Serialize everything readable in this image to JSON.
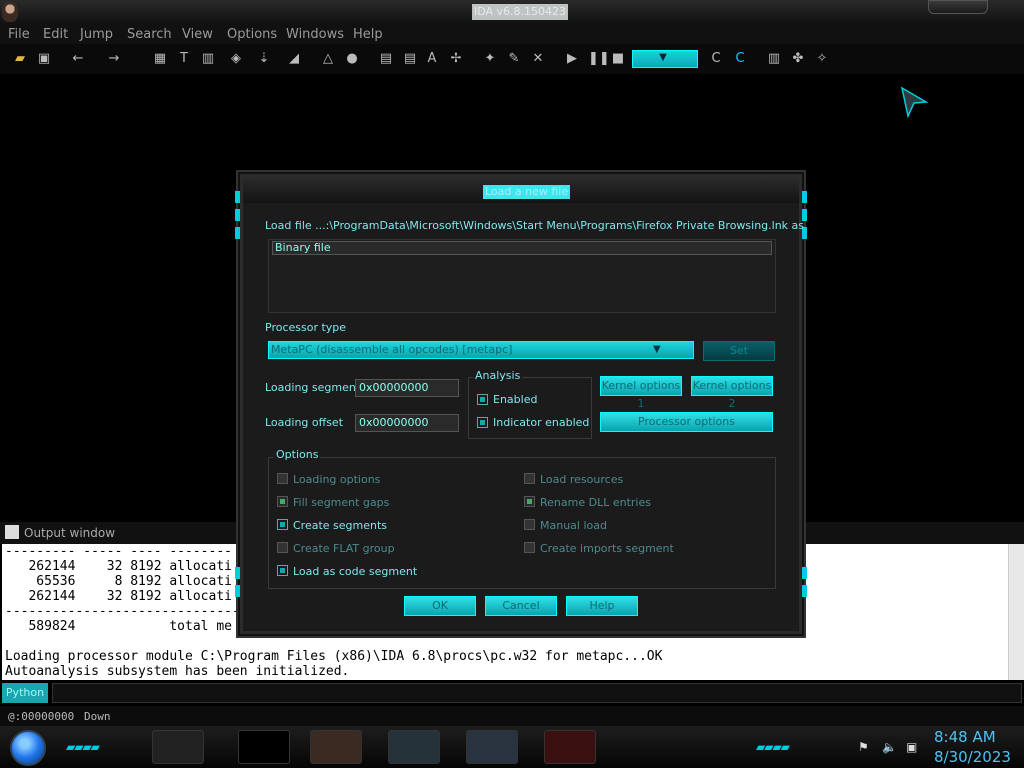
{
  "window": {
    "title": "IDA v6.8.150423"
  },
  "menu": [
    "File",
    "Edit",
    "Jump",
    "Search",
    "View",
    "Options",
    "Windows",
    "Help"
  ],
  "dialog": {
    "title": "Load a new file",
    "load_file_label": "Load file ...:\\ProgramData\\Microsoft\\Windows\\Start Menu\\Programs\\Firefox Private Browsing.lnk as",
    "format_item": "Binary file",
    "processor_type_label": "Processor type",
    "processor_value": "MetaPC (disassemble all opcodes) [metapc]",
    "set_button": "Set",
    "loading_segment_label": "Loading segment",
    "loading_segment_value": "0x00000000",
    "loading_offset_label": "Loading offset",
    "loading_offset_value": "0x00000000",
    "analysis_group": "Analysis",
    "analysis_enabled": "Enabled",
    "indicator_enabled": "Indicator enabled",
    "kernel_options_1": "Kernel options 1",
    "kernel_options_2": "Kernel options 2",
    "processor_options": "Processor options",
    "options_group": "Options",
    "opt_loading_options": "Loading options",
    "opt_fill_segment_gaps": "Fill segment gaps",
    "opt_create_segments": "Create segments",
    "opt_create_flat_group": "Create FLAT group",
    "opt_load_as_code_segment": "Load as code segment",
    "opt_load_resources": "Load resources",
    "opt_rename_dll_entries": "Rename DLL entries",
    "opt_manual_load": "Manual load",
    "opt_create_imports_segment": "Create imports segment",
    "ok_button": "OK",
    "cancel_button": "Cancel",
    "help_button": "Help"
  },
  "output": {
    "title": "Output window",
    "lines": [
      "--------- ----- ---- --------",
      "   262144    32 8192 allocati",
      "    65536     8 8192 allocati",
      "   262144    32 8192 allocati",
      "-------------------------------",
      "   589824            total me",
      "",
      "Loading processor module C:\\Program Files (x86)\\IDA 6.8\\procs\\pc.w32 for metapc...OK",
      "Autoanalysis subsystem has been initialized."
    ],
    "python_button": "Python"
  },
  "status": {
    "address": "@:00000000",
    "direction": "Down"
  },
  "taskbar": {
    "time": "8:48 AM",
    "date": "8/30/2023"
  }
}
